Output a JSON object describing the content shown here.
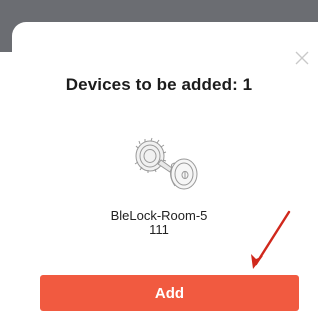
{
  "dialog": {
    "title": "Devices to be added: 1",
    "close_icon": "close-icon"
  },
  "device": {
    "name": "BleLock-Room-5",
    "subtitle": "111",
    "image_icon": "door-lock-icon"
  },
  "annotation": {
    "arrow_icon": "red-arrow-icon",
    "color": "#d0281c"
  },
  "actions": {
    "add_label": "Add",
    "add_color": "#f15a40"
  }
}
